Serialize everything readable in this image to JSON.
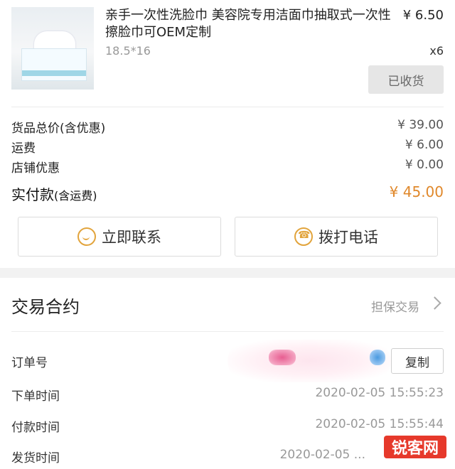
{
  "product": {
    "title_line1": "亲手一次性洗脸巾 美容院专用洁面巾抽取式一次性",
    "title_line2": "擦脸巾可OEM定制",
    "price": "¥ 6.50",
    "spec": "18.5*16",
    "qty": "x6",
    "status_button": "已收货"
  },
  "summary": {
    "goods_total_label": "货品总价(含优惠)",
    "goods_total_value": "¥ 39.00",
    "shipping_label": "运费",
    "shipping_value": "¥ 6.00",
    "store_discount_label": "店铺优惠",
    "store_discount_value": "¥ 0.00",
    "paid_label": "实付款",
    "paid_label_suffix": "(含运费)",
    "paid_value": "¥ 45.00"
  },
  "actions": {
    "contact": "立即联系",
    "call": "拨打电话"
  },
  "contract": {
    "title": "交易合约",
    "type": "担保交易"
  },
  "order": {
    "order_no_label": "订单号",
    "copy_button": "复制",
    "placed_label": "下单时间",
    "placed_value": "2020-02-05 15:55:23",
    "paid_label": "付款时间",
    "paid_value": "2020-02-05 15:55:44",
    "shipped_label": "发货时间",
    "shipped_value": "2020-02-05 ..."
  },
  "watermark": "锐客网",
  "colors": {
    "accent_orange": "#e0882b",
    "icon_orange": "#e2a43c",
    "watermark_red": "#e6392b"
  }
}
